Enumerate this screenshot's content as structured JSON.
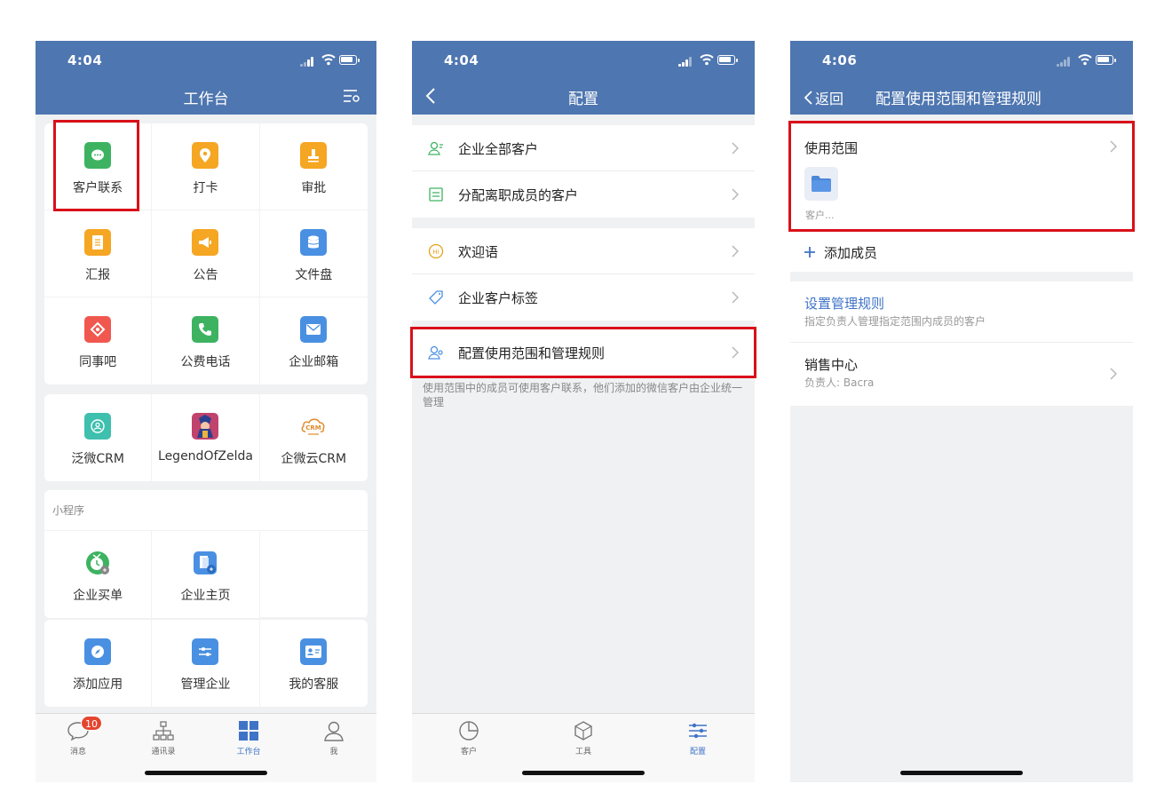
{
  "colors": {
    "header": "#4e76b0",
    "accent": "#3f73c7",
    "highlight": "#d9101a",
    "badge": "#e5452f"
  },
  "phone1": {
    "time": "4:04",
    "title": "工作台",
    "apps": [
      {
        "label": "客户联系",
        "icon": "chat-bubble-icon",
        "color": "#3db361"
      },
      {
        "label": "打卡",
        "icon": "location-pin-icon",
        "color": "#f5a623"
      },
      {
        "label": "审批",
        "icon": "stamp-icon",
        "color": "#f5a623"
      },
      {
        "label": "汇报",
        "icon": "report-icon",
        "color": "#f5a623"
      },
      {
        "label": "公告",
        "icon": "megaphone-icon",
        "color": "#f5a623"
      },
      {
        "label": "文件盘",
        "icon": "database-icon",
        "color": "#4a90e2"
      },
      {
        "label": "同事吧",
        "icon": "colleague-icon",
        "color": "#f0584f"
      },
      {
        "label": "公费电话",
        "icon": "phone-icon",
        "color": "#3db361"
      },
      {
        "label": "企业邮箱",
        "icon": "mail-icon",
        "color": "#4a90e2"
      }
    ],
    "apps2": [
      {
        "label": "泛微CRM",
        "icon": "crm-circle-icon",
        "color": "#3fbfae"
      },
      {
        "label": "LegendOfZelda",
        "icon": "game-avatar-icon",
        "color": "#c0436e"
      },
      {
        "label": "企微云CRM",
        "icon": "cloud-crm-icon",
        "color": "#ffffff"
      }
    ],
    "miniprogram_label": "小程序",
    "miniapps": [
      {
        "label": "企业买单",
        "icon": "bill-icon",
        "color": "#3db361"
      },
      {
        "label": "企业主页",
        "icon": "homepage-icon",
        "color": "#4a90e2"
      }
    ],
    "apps3": [
      {
        "label": "添加应用",
        "icon": "compass-icon",
        "color": "#4a90e2"
      },
      {
        "label": "管理企业",
        "icon": "sliders-icon",
        "color": "#4a90e2"
      },
      {
        "label": "我的客服",
        "icon": "service-card-icon",
        "color": "#4a90e2"
      }
    ],
    "tabs": [
      {
        "label": "消息",
        "icon": "message-icon",
        "badge": "10"
      },
      {
        "label": "通讯录",
        "icon": "org-chart-icon"
      },
      {
        "label": "工作台",
        "icon": "grid-icon",
        "active": true
      },
      {
        "label": "我",
        "icon": "person-icon"
      }
    ]
  },
  "phone2": {
    "time": "4:04",
    "title": "配置",
    "group1": [
      {
        "label": "企业全部客户",
        "icon": "customers-icon"
      },
      {
        "label": "分配离职成员的客户",
        "icon": "assign-doc-icon"
      }
    ],
    "group2": [
      {
        "label": "欢迎语",
        "icon": "hi-icon"
      },
      {
        "label": "企业客户标签",
        "icon": "tag-icon"
      }
    ],
    "group3": [
      {
        "label": "配置使用范围和管理规则",
        "icon": "member-config-icon"
      }
    ],
    "hint": "使用范围中的成员可使用客户联系，他们添加的微信客户由企业统一管理",
    "tabs": [
      {
        "label": "客户",
        "icon": "pie-icon"
      },
      {
        "label": "工具",
        "icon": "cube-icon"
      },
      {
        "label": "配置",
        "icon": "config-sliders-icon",
        "active": true
      }
    ]
  },
  "phone3": {
    "time": "4:06",
    "back_label": "返回",
    "title": "配置使用范围和管理规则",
    "scope_label": "使用范围",
    "scope_item": "客户...",
    "add_member": "添加成员",
    "rules_title": "设置管理规则",
    "rules_desc": "指定负责人管理指定范围内成员的客户",
    "sales_title": "销售中心",
    "sales_owner": "负责人: Bacra"
  }
}
